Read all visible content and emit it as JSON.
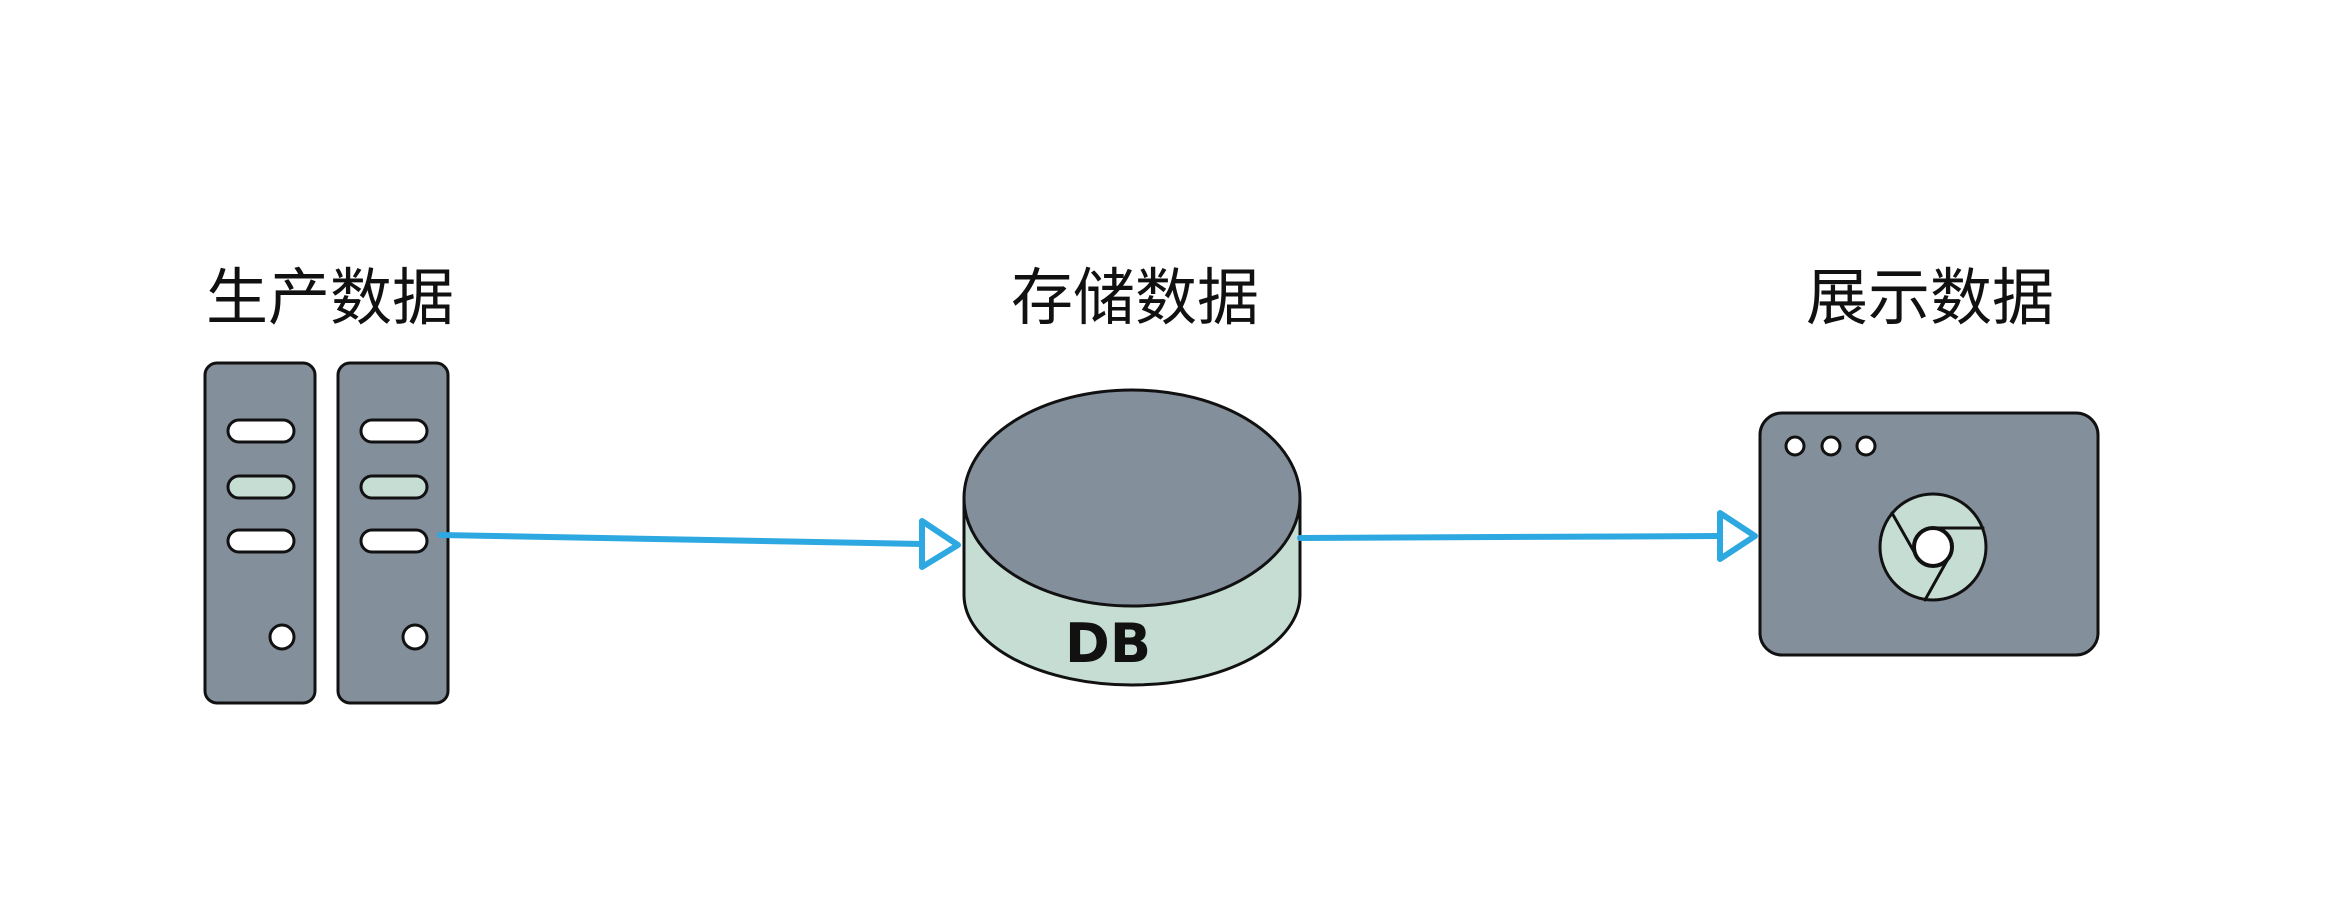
{
  "nodes": {
    "produce": {
      "label": "生产数据",
      "icon": "server-rack-icon"
    },
    "store": {
      "label": "存储数据",
      "icon": "database-cylinder-icon",
      "inner_text": "DB"
    },
    "display": {
      "label": "展示数据",
      "icon": "browser-window-icon",
      "inner_icon": "chrome-logo-icon"
    }
  },
  "edges": [
    {
      "from": "produce",
      "to": "store"
    },
    {
      "from": "store",
      "to": "display"
    }
  ],
  "colors": {
    "device_fill": "#848f9c",
    "light_fill": "#c6ddd4",
    "outline": "#111111",
    "arrow": "#2ea8e0",
    "white": "#ffffff"
  }
}
